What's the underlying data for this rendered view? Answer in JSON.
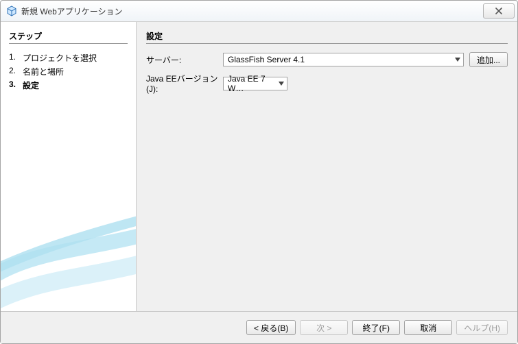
{
  "window": {
    "title": "新規 Webアプリケーション"
  },
  "left": {
    "heading": "ステップ",
    "steps": [
      {
        "num": "1.",
        "label": "プロジェクトを選択",
        "current": false
      },
      {
        "num": "2.",
        "label": "名前と場所",
        "current": false
      },
      {
        "num": "3.",
        "label": "設定",
        "current": true
      }
    ]
  },
  "right": {
    "heading": "設定",
    "server_label": "サーバー:",
    "server_value": "GlassFish Server 4.1",
    "add_button": "追加...",
    "version_label": "Java EEバージョン(J):",
    "version_value": "Java EE 7 W…"
  },
  "footer": {
    "back": "< 戻る(B)",
    "next": "次 >",
    "finish": "終了(F)",
    "cancel": "取消",
    "help": "ヘルプ(H)"
  }
}
